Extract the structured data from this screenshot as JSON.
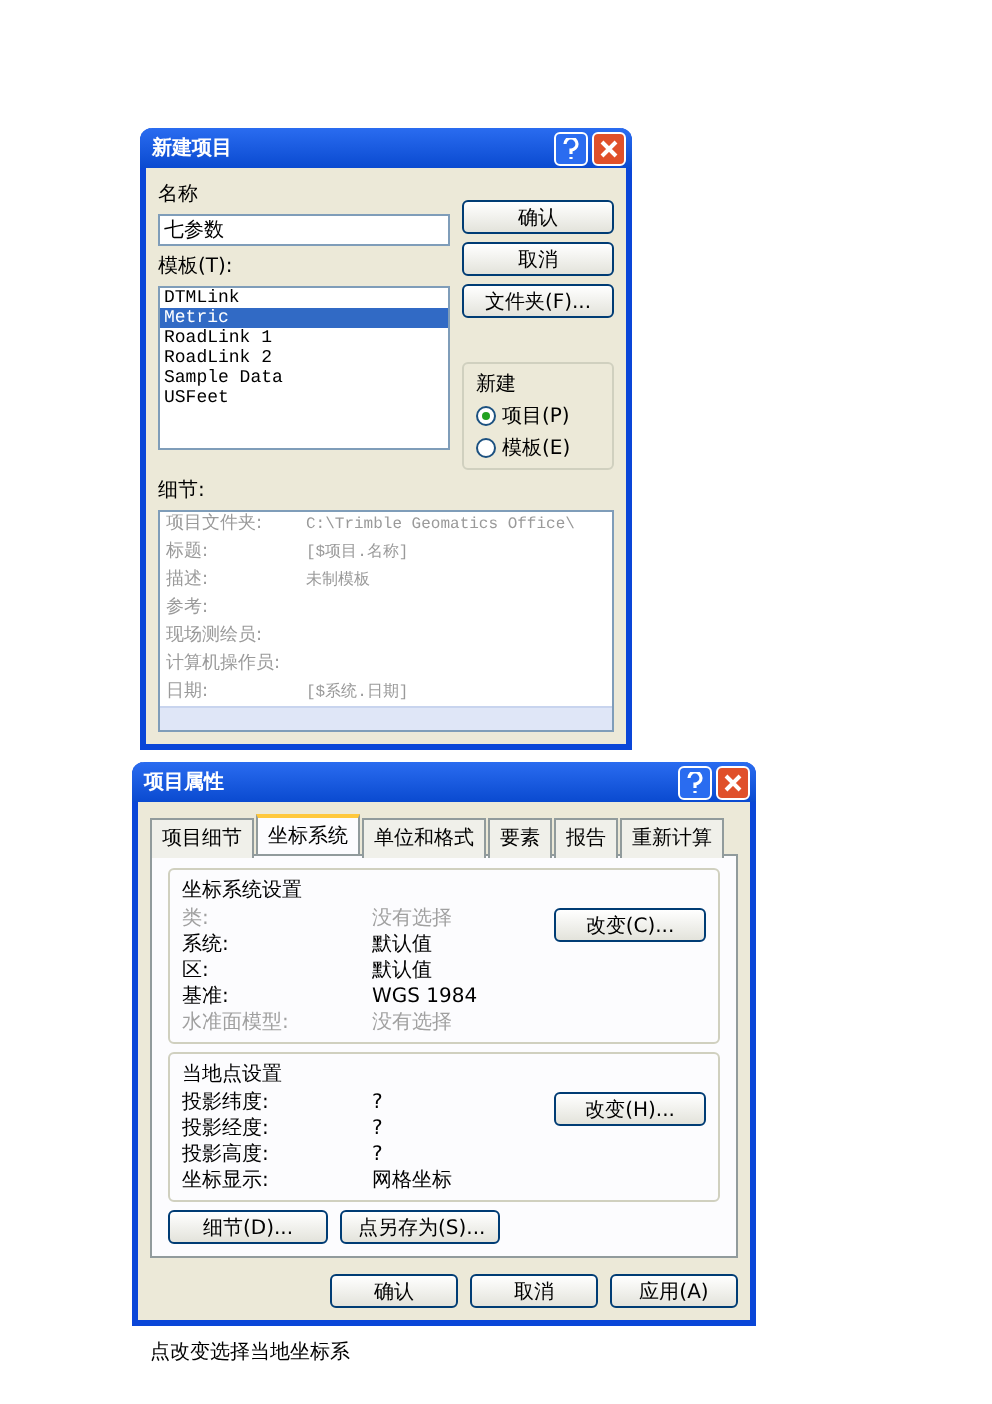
{
  "new_project_dialog": {
    "title": "新建项目",
    "name_label": "名称",
    "name_value": "七参数",
    "template_label": "模板(T):",
    "templates": [
      {
        "label": "DTMLink",
        "selected": false
      },
      {
        "label": "Metric",
        "selected": true
      },
      {
        "label": "RoadLink 1",
        "selected": false
      },
      {
        "label": "RoadLink 2",
        "selected": false
      },
      {
        "label": "Sample Data",
        "selected": false
      },
      {
        "label": "USFeet",
        "selected": false
      }
    ],
    "buttons": [
      "确认",
      "取消",
      "文件夹(F)..."
    ],
    "new_group": {
      "title": "新建",
      "options": [
        {
          "label": "项目(P)",
          "selected": true
        },
        {
          "label": "模板(E)",
          "selected": false
        }
      ]
    },
    "details_label": "细节:",
    "details": [
      {
        "label": "项目文件夹:",
        "value": "C:\\Trimble Geomatics Office\\"
      },
      {
        "label": "标题:",
        "value": "[$项目.名称]"
      },
      {
        "label": "描述:",
        "value": "未制模板"
      },
      {
        "label": "参考:"
      },
      {
        "label": "现场测绘员:"
      },
      {
        "label": "计算机操作员:"
      },
      {
        "label": "日期:",
        "value": "[$系统.日期]"
      }
    ]
  },
  "project_properties_dialog": {
    "title": "项目属性",
    "tabs": [
      {
        "label": "项目细节",
        "selected": false
      },
      {
        "label": "坐标系统",
        "selected": true
      },
      {
        "label": "单位和格式",
        "selected": false
      },
      {
        "label": "要素",
        "selected": false
      },
      {
        "label": "报告",
        "selected": false
      },
      {
        "label": "重新计算",
        "selected": false
      }
    ],
    "groups": [
      {
        "title": "坐标系统设置",
        "button": "改变(C)...",
        "rows": [
          {
            "label": "类:",
            "value": "没有选择",
            "disabled": true
          },
          {
            "label": "系统:",
            "value": "默认值",
            "disabled": false
          },
          {
            "label": "区:",
            "value": "默认值",
            "disabled": false
          },
          {
            "label": "基准:",
            "value": "WGS 1984",
            "disabled": false
          },
          {
            "label": "水准面模型:",
            "value": "没有选择",
            "disabled": true
          }
        ]
      },
      {
        "title": "当地点设置",
        "button": "改变(H)...",
        "rows": [
          {
            "label": "投影纬度:",
            "value": "?",
            "disabled": false
          },
          {
            "label": "投影经度:",
            "value": "?",
            "disabled": false
          },
          {
            "label": "投影高度:",
            "value": "?",
            "disabled": false
          },
          {
            "label": "坐标显示:",
            "value": "网格坐标",
            "disabled": false
          }
        ]
      }
    ],
    "tab_buttons": [
      "细节(D)...",
      "点另存为(S)..."
    ],
    "footer_buttons": [
      "确认",
      "取消",
      "应用(A)"
    ]
  },
  "caption": "点改变选择当地坐标系"
}
